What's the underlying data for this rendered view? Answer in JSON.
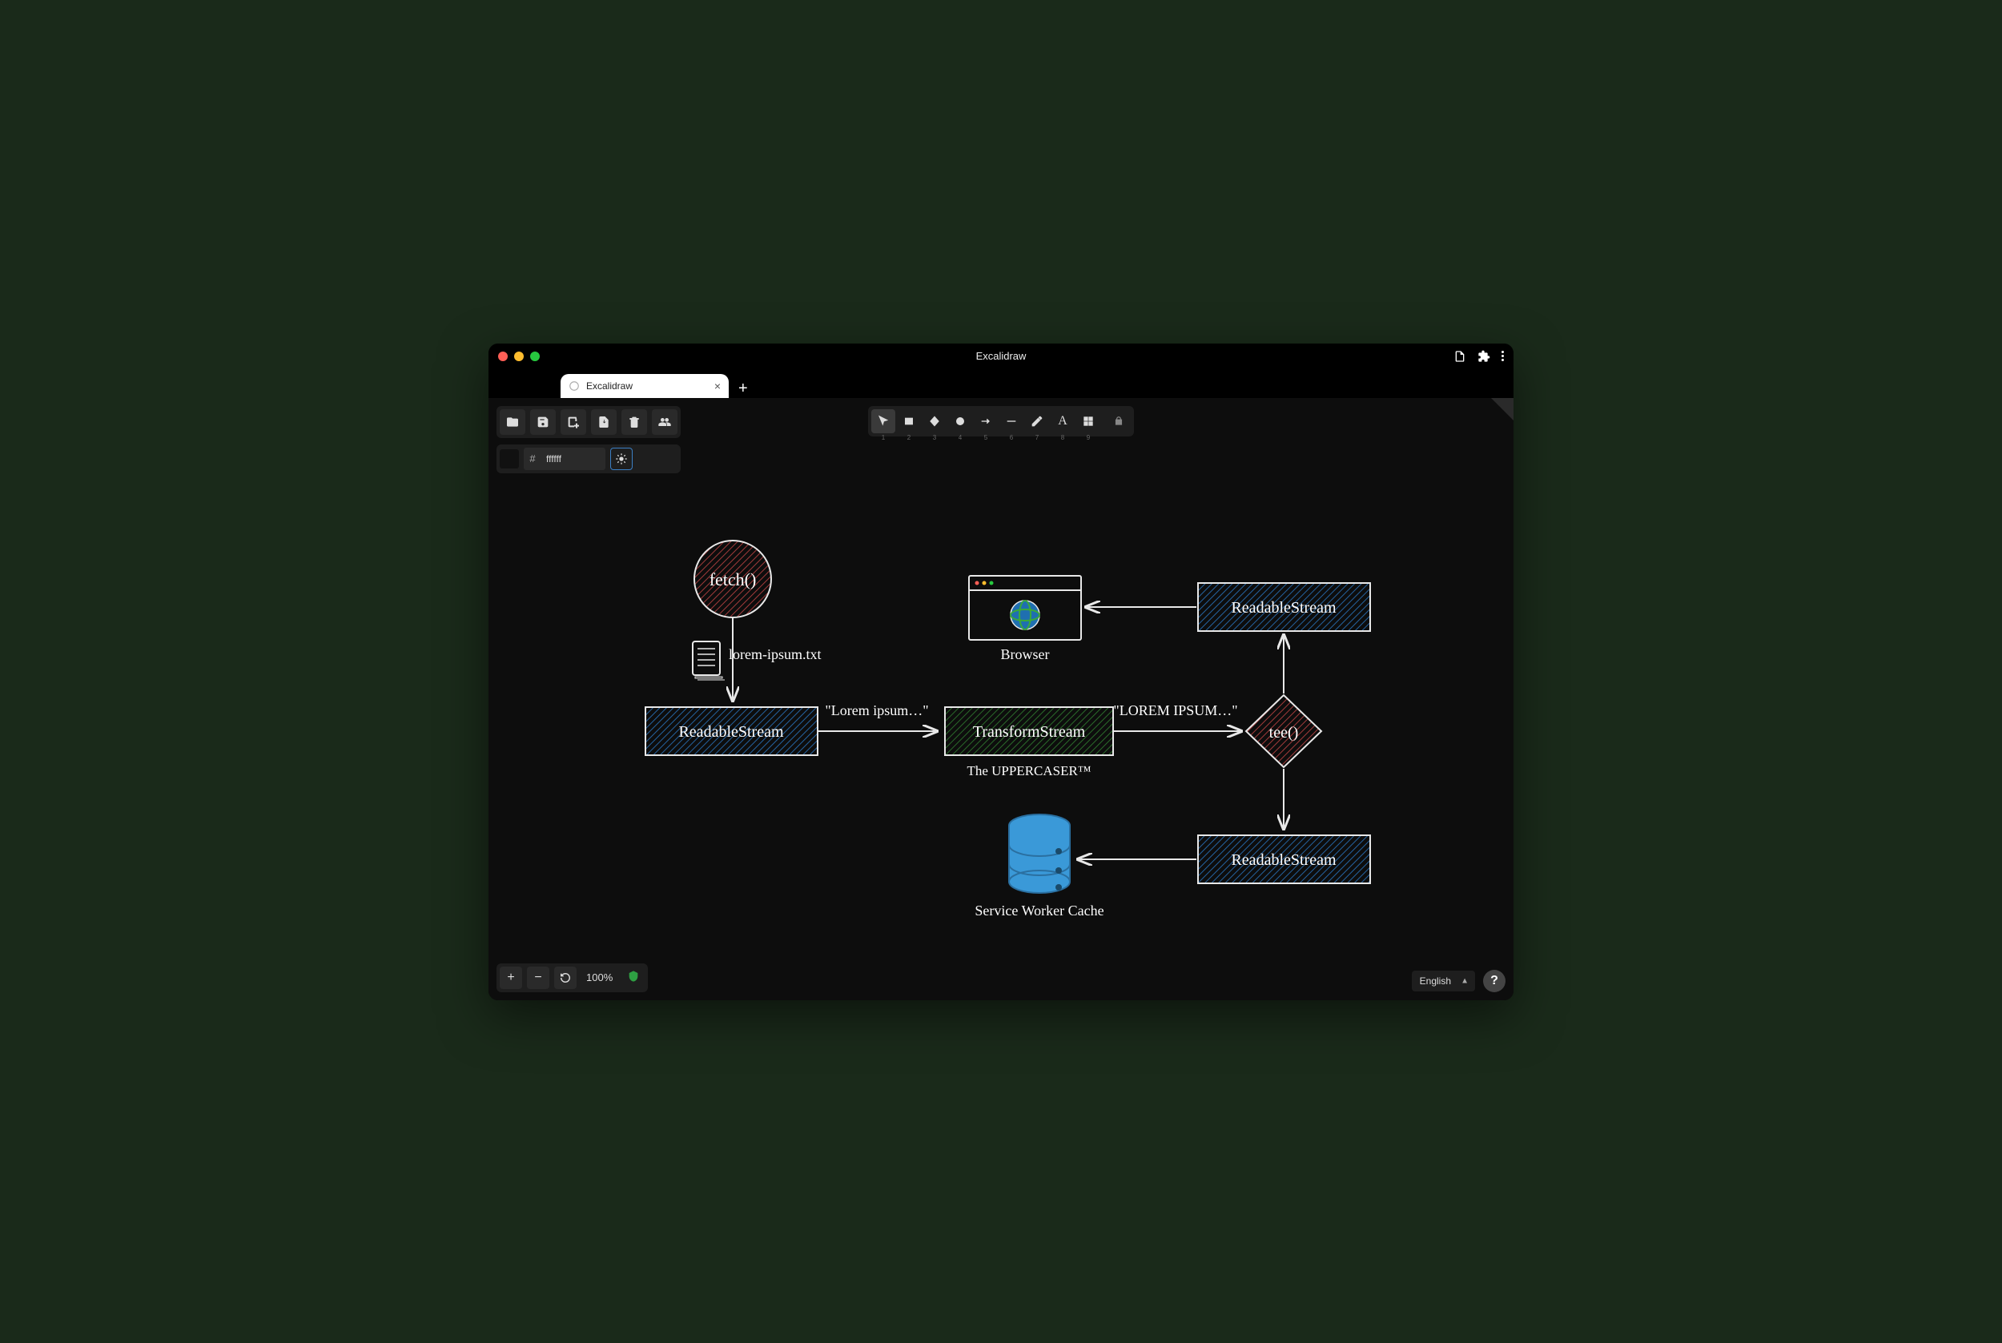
{
  "window": {
    "title": "Excalidraw"
  },
  "tab": {
    "title": "Excalidraw"
  },
  "color": {
    "hex": "ffffff"
  },
  "tools": {
    "shortcuts": [
      "1",
      "2",
      "3",
      "4",
      "5",
      "6",
      "7",
      "8",
      "9"
    ]
  },
  "zoom": {
    "label": "100%"
  },
  "language": {
    "selected": "English"
  },
  "diagram": {
    "fetch": "fetch()",
    "file": "lorem-ipsum.txt",
    "readable1": "ReadableStream",
    "arrow1_label": "\"Lorem ipsum…\"",
    "transform": "TransformStream",
    "transform_sub": "The UPPERCASER™",
    "arrow2_label": "\"LOREM IPSUM…\"",
    "tee": "tee()",
    "readable2": "ReadableStream",
    "browser": "Browser",
    "readable3": "ReadableStream",
    "cache": "Service Worker Cache"
  }
}
